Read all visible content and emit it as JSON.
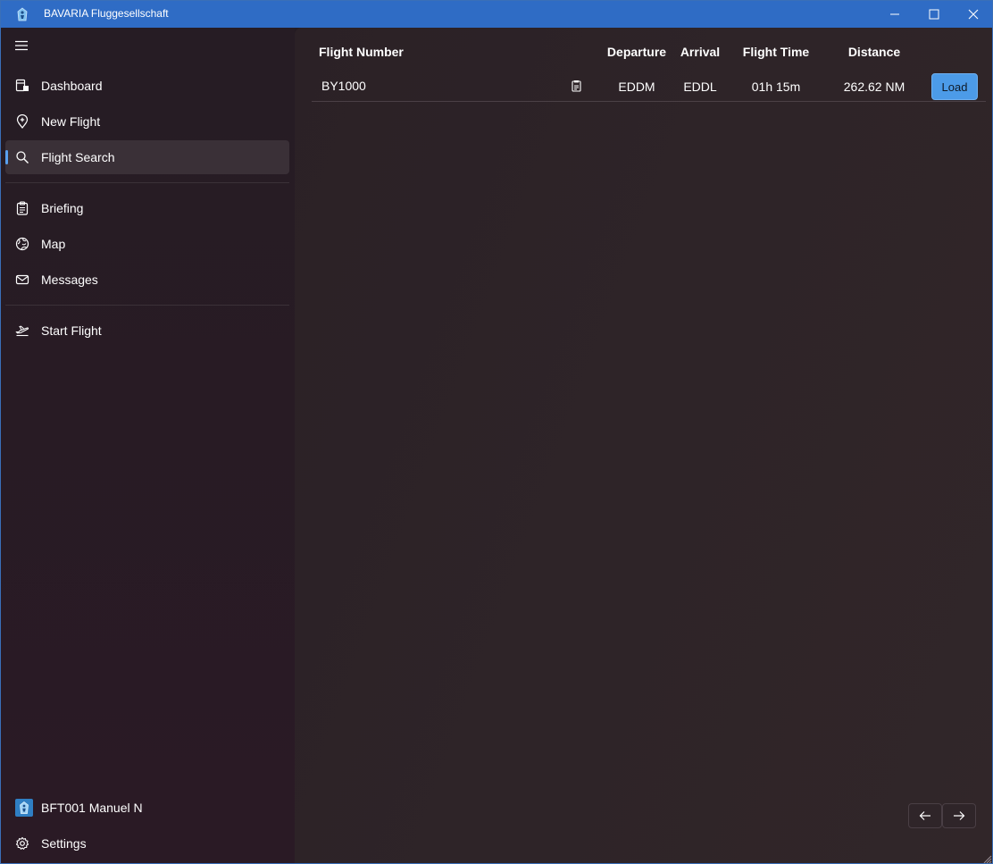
{
  "window": {
    "title": "BAVARIA Fluggesellschaft",
    "accent": "#2f6cc5"
  },
  "sidebar": {
    "menu_icon": "hamburger-icon",
    "items_top": [
      {
        "label": "Dashboard",
        "icon": "dashboard-icon"
      },
      {
        "label": "New Flight",
        "icon": "map-pin-plus-icon"
      },
      {
        "label": "Flight Search",
        "icon": "search-icon",
        "selected": true
      }
    ],
    "items_middle": [
      {
        "label": "Briefing",
        "icon": "clipboard-icon"
      },
      {
        "label": "Map",
        "icon": "globe-icon"
      },
      {
        "label": "Messages",
        "icon": "mail-icon"
      }
    ],
    "items_bottom": [
      {
        "label": "Start Flight",
        "icon": "airplane-takeoff-icon"
      }
    ],
    "user": {
      "label": "BFT001 Manuel N",
      "icon": "avatar"
    },
    "settings": {
      "label": "Settings",
      "icon": "gear-icon"
    },
    "selected_color": "#5aa0ee"
  },
  "table": {
    "headers": {
      "flight_number": "Flight Number",
      "departure": "Departure",
      "arrival": "Arrival",
      "flight_time": "Flight Time",
      "distance": "Distance"
    },
    "rows": [
      {
        "flight_number": "BY1000",
        "departure": "EDDM",
        "arrival": "EDDL",
        "flight_time": "01h 15m",
        "distance": "262.62 NM",
        "action": "Load"
      }
    ]
  },
  "pagination": {
    "prev_icon": "arrow-left-icon",
    "next_icon": "arrow-right-icon"
  }
}
